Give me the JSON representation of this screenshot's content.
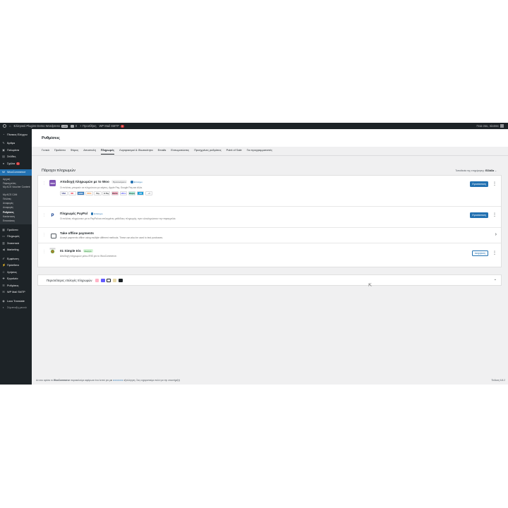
{
  "adminbar": {
    "site_name": "Ελληνικό Plugins Demo Wordpress",
    "live_badge": "Live",
    "comments_count": "0",
    "new_label": "Προσθήκη",
    "smtp_label": "WP Mail SMTP",
    "smtp_count": "1",
    "greeting": "Γεια σου, nicotec"
  },
  "sidebar": {
    "items": [
      {
        "label": "Πίνακας Ελέγχου",
        "icon": "dashboard-icon"
      },
      {
        "label": "Άρθρα",
        "icon": "pin-icon"
      },
      {
        "label": "Πολυμέσα",
        "icon": "media-icon"
      },
      {
        "label": "Σελίδες",
        "icon": "page-icon"
      },
      {
        "label": "Σχόλια",
        "icon": "comment-icon",
        "badge": "1"
      }
    ],
    "woo_label": "WooCommerce",
    "woo_submenu": [
      "Αρχική",
      "Παραγγελίες",
      "My ACS Voucher Content",
      "My ACS CAN",
      "Πελάτες",
      "Αναφορές",
      "Αναφορές",
      "Ρυθμίσεις",
      "Κατάσταση",
      "Επεκτάσεις"
    ],
    "woo_current": "Ρυθμίσεις",
    "items2": [
      {
        "label": "Προϊόντα",
        "icon": "box-icon"
      },
      {
        "label": "Πληρωμές",
        "icon": "payment-icon"
      },
      {
        "label": "Στατιστικά",
        "icon": "chart-icon"
      },
      {
        "label": "Marketing",
        "icon": "megaphone-icon"
      }
    ],
    "items3": [
      {
        "label": "Εμφάνιση",
        "icon": "brush-icon"
      },
      {
        "label": "Πρόσθετα",
        "icon": "plugin-icon"
      },
      {
        "label": "Χρήστες",
        "icon": "user-icon"
      },
      {
        "label": "Εργαλεία",
        "icon": "wrench-icon"
      },
      {
        "label": "Ρυθμίσεις",
        "icon": "settings-icon"
      },
      {
        "label": "WP Mail SMTP",
        "icon": "mail-icon"
      }
    ],
    "items4": [
      {
        "label": "Loco Translate",
        "icon": "translate-icon"
      },
      {
        "label": "Σύμπτυξη μενού",
        "icon": "collapse-icon"
      }
    ]
  },
  "page": {
    "title": "Ρυθμίσεις",
    "tabs": [
      "Γενικά",
      "Προϊόντα",
      "Φόρος",
      "Αποστολή",
      "Πληρωμές",
      "Λογαριασμοί & Ιδιωτικότητα",
      "Emails",
      "Ενσωματώσεις",
      "Προηγμένες ρυθμίσεις",
      "Point of Sale",
      "Για προγραμματιστές"
    ],
    "active_tab": "Πληρωμές",
    "section_title": "Πάροχοι πληρωμών",
    "store_location_label": "Τοποθεσία της επιχείρησης:",
    "store_location_value": "Ελλάδα"
  },
  "providers": [
    {
      "name": "Αποδοχή πληρωμών με το Woo",
      "badge": "Προτεινόμενο",
      "info": "Επίσημο",
      "desc": "Οι πελάτες μπορούν να πληρώνουν με κάρτες, Apple Pay, Google Pay και άλλα.",
      "button": "Εγκατάσταση",
      "logo_text": "woo",
      "logo_color": "#7f54b3",
      "marks": [
        "VISA",
        "MC",
        "AMEX",
        "DISC",
        "Pay",
        "G Pay",
        "klarna",
        "affirm",
        "afterpay",
        "CB",
        "+ 8"
      ]
    },
    {
      "name": "Πληρωμές PayPal",
      "info": "Επίσημο",
      "desc": "Οι πελάτες πληρώνουν με το PayPal και επιλεγμένες μεθόδους πληρωμής, πριν ολοκληρώσουν την παραγγελία.",
      "button": "Εγκατάσταση",
      "logo_text": "P",
      "logo_color": "#ffffff"
    },
    {
      "name": "Take offline payments",
      "desc": "Accept payments offline using multiple different methods. These can also be used to test purchases.",
      "logo_color": "#ffffff"
    },
    {
      "name": "01 Simple Iris",
      "badge": "Ενεργό",
      "desc": "Αποδοχή πληρωμών μέσω IRIS για το WooCommerce.",
      "button": "Διαχείριση",
      "logo_color": "#ffffff"
    }
  ],
  "other_options": {
    "label": "Περισσότερες επιλογές πληρωμών",
    "marks": [
      {
        "name": "klarna-mark",
        "color": "#ffb3c7"
      },
      {
        "name": "stripe-mark",
        "color": "#635bff"
      },
      {
        "name": "square-mark",
        "color": "#1d2327"
      },
      {
        "name": "mollie-mark",
        "color": "#f5e9d0"
      },
      {
        "name": "airwallex-mark",
        "color": "#1d2327"
      }
    ]
  },
  "footer": {
    "text_before": "Αν σου αρέσει το",
    "brand": "WooCommerce",
    "text_mid": "παρακαλούμε αφιέρωσε ένα λεπτό για μια",
    "stars": "★★★★★",
    "text_after": "αξιολόγηση. Σας ευχαριστούμε πολύ για την υποστήριξη!",
    "version": "Έκδοση 6.8.2"
  },
  "colors": {
    "accent": "#2271b1",
    "sidebar_bg": "#1d2327",
    "woo_purple": "#7f54b3"
  }
}
